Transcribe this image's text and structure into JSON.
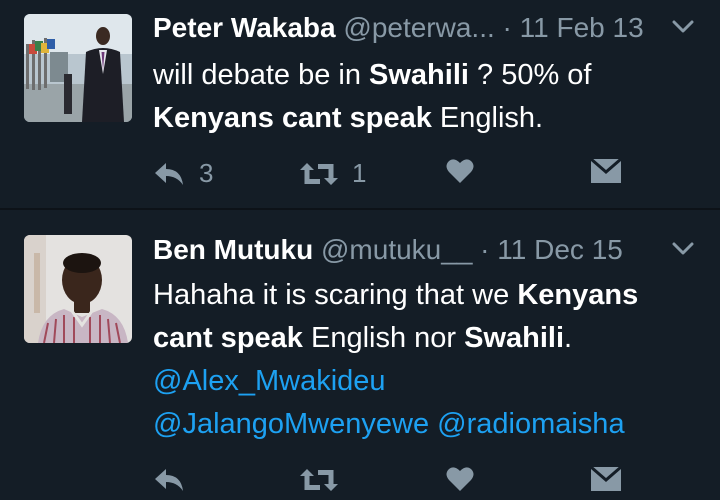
{
  "tweets": [
    {
      "name": "Peter Wakaba",
      "handle": "@peterwa...",
      "dot": "·",
      "date": "11 Feb 13",
      "text": {
        "t1": "will debate be in ",
        "b1": "Swahili",
        "t2": " ? 50% of",
        "b2": "Kenyans cant speak",
        "t3": " English."
      },
      "reply_count": "3",
      "retweet_count": "1"
    },
    {
      "name": "Ben Mutuku",
      "handle": "@mutuku__",
      "dot": "·",
      "date": "11 Dec 15",
      "text": {
        "t1": "Hahaha it is scaring that we ",
        "b1": "Kenyans",
        "b2": "cant speak",
        "t2": " English nor ",
        "b3": "Swahili",
        "t3": ".",
        "m1": "@Alex_Mwakideu",
        "m2": "@JalangoMwenyewe",
        "m3": "@radiomaisha"
      },
      "reply_count": "",
      "retweet_count": ""
    }
  ],
  "icons": {
    "reply": "reply-icon",
    "retweet": "retweet-icon",
    "like": "heart-icon",
    "dm": "envelope-icon",
    "more": "chevron-down-icon"
  },
  "colors": {
    "background": "#141d26",
    "text": "#ffffff",
    "muted": "#8899a6",
    "link": "#1da1f2"
  }
}
